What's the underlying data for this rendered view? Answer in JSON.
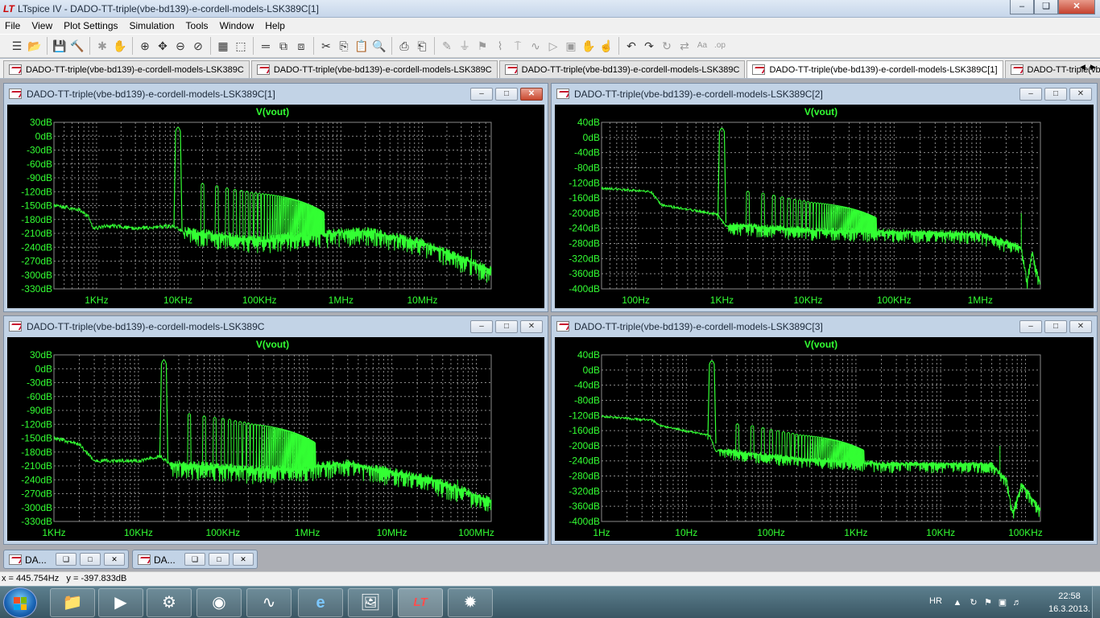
{
  "window": {
    "app_logo": "LT",
    "title": "LTspice IV - DADO-TT-triple(vbe-bd139)-e-cordell-models-LSK389C[1]",
    "minimize": "–",
    "maximize": "❏",
    "close": "✕"
  },
  "menu": [
    "File",
    "View",
    "Plot Settings",
    "Simulation",
    "Tools",
    "Window",
    "Help"
  ],
  "toolbar_icons": [
    {
      "name": "new-schematic-icon",
      "glyph": "☰",
      "enabled": true
    },
    {
      "name": "open-icon",
      "glyph": "📂",
      "enabled": true
    },
    {
      "name": "save-icon",
      "glyph": "💾",
      "enabled": true
    },
    {
      "name": "control-panel-icon",
      "glyph": "🔨",
      "enabled": true
    },
    {
      "name": "run-icon",
      "glyph": "✱",
      "enabled": false
    },
    {
      "name": "pan-icon",
      "glyph": "✋",
      "enabled": false
    },
    {
      "name": "zoom-in-icon",
      "glyph": "⊕",
      "enabled": true
    },
    {
      "name": "zoom-pan-icon",
      "glyph": "✥",
      "enabled": true
    },
    {
      "name": "zoom-out-icon",
      "glyph": "⊖",
      "enabled": true
    },
    {
      "name": "zoom-cancel-icon",
      "glyph": "⊘",
      "enabled": true
    },
    {
      "name": "autorange-icon",
      "glyph": "▦",
      "enabled": true
    },
    {
      "name": "fit-icon",
      "glyph": "⬚",
      "enabled": true
    },
    {
      "name": "tile-horizontal-icon",
      "glyph": "═",
      "enabled": true
    },
    {
      "name": "cascade-icon",
      "glyph": "⧉",
      "enabled": true
    },
    {
      "name": "close-windows-icon",
      "glyph": "⧈",
      "enabled": true
    },
    {
      "name": "cut-icon",
      "glyph": "✂",
      "enabled": true
    },
    {
      "name": "copy-icon",
      "glyph": "⎘",
      "enabled": true
    },
    {
      "name": "paste-icon",
      "glyph": "📋",
      "enabled": true
    },
    {
      "name": "find-icon",
      "glyph": "🔍",
      "enabled": true
    },
    {
      "name": "print-preview-icon",
      "glyph": "⎙",
      "enabled": true
    },
    {
      "name": "print-icon",
      "glyph": "⎗",
      "enabled": true
    },
    {
      "name": "wire-icon",
      "glyph": "✎",
      "enabled": false
    },
    {
      "name": "ground-icon",
      "glyph": "⏚",
      "enabled": false
    },
    {
      "name": "label-icon",
      "glyph": "⚑",
      "enabled": false
    },
    {
      "name": "resistor-icon",
      "glyph": "⌇",
      "enabled": false
    },
    {
      "name": "capacitor-icon",
      "glyph": "⍑",
      "enabled": false
    },
    {
      "name": "inductor-icon",
      "glyph": "∿",
      "enabled": false
    },
    {
      "name": "diode-icon",
      "glyph": "▷",
      "enabled": false
    },
    {
      "name": "component-icon",
      "glyph": "▣",
      "enabled": false
    },
    {
      "name": "move-icon",
      "glyph": "✋",
      "enabled": false
    },
    {
      "name": "drag-icon",
      "glyph": "☝",
      "enabled": false
    },
    {
      "name": "undo-icon",
      "glyph": "↶",
      "enabled": true
    },
    {
      "name": "redo-icon",
      "glyph": "↷",
      "enabled": true
    },
    {
      "name": "rotate-icon",
      "glyph": "↻",
      "enabled": false
    },
    {
      "name": "mirror-icon",
      "glyph": "⇄",
      "enabled": false
    },
    {
      "name": "text-icon",
      "glyph": "Aa",
      "enabled": false
    },
    {
      "name": "spice-directive-icon",
      "glyph": ".op",
      "enabled": false
    }
  ],
  "doc_tabs": [
    {
      "label": "DADO-TT-triple(vbe-bd139)-e-cordell-models-LSK389C",
      "kind": "schematic",
      "active": false
    },
    {
      "label": "DADO-TT-triple(vbe-bd139)-e-cordell-models-LSK389C",
      "kind": "plot",
      "active": false
    },
    {
      "label": "DADO-TT-triple(vbe-bd139)-e-cordell-models-LSK389C",
      "kind": "plot",
      "active": false
    },
    {
      "label": "DADO-TT-triple(vbe-bd139)-e-cordell-models-LSK389C[1]",
      "kind": "plot",
      "active": true
    },
    {
      "label": "DADO-TT-triple(vbe-bd13",
      "kind": "plot",
      "active": false
    }
  ],
  "tab_scroll": [
    "◀",
    "▶"
  ],
  "panes": [
    {
      "id": "pane-1",
      "title": "DADO-TT-triple(vbe-bd139)-e-cordell-models-LSK389C[1]",
      "active": true,
      "trace_label": "V(vout)",
      "colors": {
        "trace": "#33ff33",
        "grid": "#8a8a8a",
        "axis": "#33ff33"
      },
      "chart_data": {
        "type": "line",
        "x_scale": "log",
        "y_unit": "dB",
        "xlim_hz": [
          300,
          70000000
        ],
        "ylim_db": [
          -330,
          30
        ],
        "y_ticks": [
          30,
          0,
          -30,
          -60,
          -90,
          -120,
          -150,
          -180,
          -210,
          -240,
          -270,
          -300,
          -330
        ],
        "y_tick_labels": [
          "30dB",
          "0dB",
          "-30dB",
          "-60dB",
          "-90dB",
          "-120dB",
          "-150dB",
          "-180dB",
          "-210dB",
          "-240dB",
          "-270dB",
          "-300dB",
          "-330dB"
        ],
        "x_ticks": [
          1000,
          10000,
          100000,
          1000000,
          10000000
        ],
        "x_tick_labels": [
          "1KHz",
          "10KHz",
          "100KHz",
          "1MHz",
          "10MHz"
        ],
        "fundamental_hz": 10000,
        "fundamental_db": 20,
        "harmonic_peak_db": [
          -105,
          -110,
          -115,
          -118,
          -120,
          -122,
          -124,
          -125,
          -126,
          -127
        ],
        "noise_floor": [
          {
            "x": 300,
            "y": -145
          },
          {
            "x": 600,
            "y": -155
          },
          {
            "x": 800,
            "y": -170
          },
          {
            "x": 900,
            "y": -195
          },
          {
            "x": 1500,
            "y": -190
          },
          {
            "x": 3000,
            "y": -195
          },
          {
            "x": 9000,
            "y": -190
          },
          {
            "x": 12000,
            "y": -205
          },
          {
            "x": 100000,
            "y": -225
          },
          {
            "x": 300000,
            "y": -215
          },
          {
            "x": 2000000,
            "y": -205
          },
          {
            "x": 10000000,
            "y": -230
          },
          {
            "x": 70000000,
            "y": -290
          }
        ],
        "noise_band_db": 40,
        "spurs": [
          {
            "x": 40000000,
            "y": -245
          }
        ]
      }
    },
    {
      "id": "pane-2",
      "title": "DADO-TT-triple(vbe-bd139)-e-cordell-models-LSK389C[2]",
      "active": false,
      "trace_label": "V(vout)",
      "colors": {
        "trace": "#33ff33",
        "grid": "#8a8a8a",
        "axis": "#33ff33"
      },
      "chart_data": {
        "type": "line",
        "x_scale": "log",
        "y_unit": "dB",
        "xlim_hz": [
          40,
          5000000
        ],
        "ylim_db": [
          -400,
          40
        ],
        "y_ticks": [
          40,
          0,
          -40,
          -80,
          -120,
          -160,
          -200,
          -240,
          -280,
          -320,
          -360,
          -400
        ],
        "y_tick_labels": [
          "40dB",
          "0dB",
          "-40dB",
          "-80dB",
          "-120dB",
          "-160dB",
          "-200dB",
          "-240dB",
          "-280dB",
          "-320dB",
          "-360dB",
          "-400dB"
        ],
        "x_ticks": [
          100,
          1000,
          10000,
          100000,
          1000000
        ],
        "x_tick_labels": [
          "100Hz",
          "1KHz",
          "10KHz",
          "100KHz",
          "1MHz"
        ],
        "fundamental_hz": 1000,
        "fundamental_db": 25,
        "harmonic_peak_db": [
          -145,
          -150,
          -155,
          -160,
          -163,
          -166,
          -168,
          -170,
          -172,
          -174
        ],
        "noise_floor": [
          {
            "x": 40,
            "y": -130
          },
          {
            "x": 150,
            "y": -140
          },
          {
            "x": 200,
            "y": -175
          },
          {
            "x": 900,
            "y": -200
          },
          {
            "x": 1100,
            "y": -230
          },
          {
            "x": 10000,
            "y": -245
          },
          {
            "x": 100000,
            "y": -250
          },
          {
            "x": 1000000,
            "y": -255
          },
          {
            "x": 3000000,
            "y": -290
          },
          {
            "x": 3500000,
            "y": -380
          },
          {
            "x": 4000000,
            "y": -300
          },
          {
            "x": 5000000,
            "y": -390
          }
        ],
        "noise_band_db": 35,
        "spurs": [
          {
            "x": 3000000,
            "y": -200
          }
        ]
      }
    },
    {
      "id": "pane-3",
      "title": "DADO-TT-triple(vbe-bd139)-e-cordell-models-LSK389C",
      "active": false,
      "trace_label": "V(vout)",
      "colors": {
        "trace": "#33ff33",
        "grid": "#8a8a8a",
        "axis": "#33ff33"
      },
      "chart_data": {
        "type": "line",
        "x_scale": "log",
        "y_unit": "dB",
        "xlim_hz": [
          1000,
          150000000
        ],
        "ylim_db": [
          -330,
          30
        ],
        "y_ticks": [
          30,
          0,
          -30,
          -60,
          -90,
          -120,
          -150,
          -180,
          -210,
          -240,
          -270,
          -300,
          -330
        ],
        "y_tick_labels": [
          "30dB",
          "0dB",
          "-30dB",
          "-60dB",
          "-90dB",
          "-120dB",
          "-150dB",
          "-180dB",
          "-210dB",
          "-240dB",
          "-270dB",
          "-300dB",
          "-330dB"
        ],
        "x_ticks": [
          1000,
          10000,
          100000,
          1000000,
          10000000,
          100000000
        ],
        "x_tick_labels": [
          "1KHz",
          "10KHz",
          "100KHz",
          "1MHz",
          "10MHz",
          "100MHz"
        ],
        "fundamental_hz": 20000,
        "fundamental_db": 20,
        "harmonic_peak_db": [
          -100,
          -105,
          -108,
          -110,
          -112,
          -115,
          -117,
          -118,
          -120,
          -122
        ],
        "noise_floor": [
          {
            "x": 1000,
            "y": -145
          },
          {
            "x": 2000,
            "y": -160
          },
          {
            "x": 3000,
            "y": -195
          },
          {
            "x": 10000,
            "y": -195
          },
          {
            "x": 18000,
            "y": -185
          },
          {
            "x": 25000,
            "y": -205
          },
          {
            "x": 300000,
            "y": -220
          },
          {
            "x": 3000000,
            "y": -205
          },
          {
            "x": 30000000,
            "y": -240
          },
          {
            "x": 150000000,
            "y": -285
          }
        ],
        "noise_band_db": 40,
        "spurs": [
          {
            "x": 60000000,
            "y": -240
          }
        ]
      }
    },
    {
      "id": "pane-4",
      "title": "DADO-TT-triple(vbe-bd139)-e-cordell-models-LSK389C[3]",
      "active": false,
      "trace_label": "V(vout)",
      "colors": {
        "trace": "#33ff33",
        "grid": "#8a8a8a",
        "axis": "#33ff33"
      },
      "chart_data": {
        "type": "line",
        "x_scale": "log",
        "y_unit": "dB",
        "xlim_hz": [
          1,
          150000
        ],
        "ylim_db": [
          -400,
          40
        ],
        "y_ticks": [
          40,
          0,
          -40,
          -80,
          -120,
          -160,
          -200,
          -240,
          -280,
          -320,
          -360,
          -400
        ],
        "y_tick_labels": [
          "40dB",
          "0dB",
          "-40dB",
          "-80dB",
          "-120dB",
          "-160dB",
          "-200dB",
          "-240dB",
          "-280dB",
          "-320dB",
          "-360dB",
          "-400dB"
        ],
        "x_ticks": [
          1,
          10,
          100,
          1000,
          10000,
          100000
        ],
        "x_tick_labels": [
          "1Hz",
          "10Hz",
          "100Hz",
          "1KHz",
          "10KHz",
          "100KHz"
        ],
        "fundamental_hz": 20,
        "fundamental_db": 25,
        "harmonic_peak_db": [
          -145,
          -150,
          -155,
          -160,
          -163,
          -166,
          -168,
          -170,
          -172,
          -174
        ],
        "noise_floor": [
          {
            "x": 1,
            "y": -120
          },
          {
            "x": 4,
            "y": -130
          },
          {
            "x": 5,
            "y": -145
          },
          {
            "x": 19,
            "y": -170
          },
          {
            "x": 22,
            "y": -210
          },
          {
            "x": 200,
            "y": -235
          },
          {
            "x": 2000,
            "y": -248
          },
          {
            "x": 40000,
            "y": -250
          },
          {
            "x": 60000,
            "y": -290
          },
          {
            "x": 70000,
            "y": -380
          },
          {
            "x": 90000,
            "y": -300
          },
          {
            "x": 150000,
            "y": -370
          }
        ],
        "noise_band_db": 30,
        "spurs": [
          {
            "x": 50000,
            "y": -200
          }
        ]
      }
    }
  ],
  "minimized": [
    {
      "label": "DA...",
      "icon": "schematic"
    },
    {
      "label": "DA...",
      "icon": "schematic"
    }
  ],
  "min_ctrls": [
    "❏",
    "□",
    "✕"
  ],
  "status": {
    "cursor": "x = 445.754Hz   y = -397.833dB"
  },
  "taskbar": {
    "apps": [
      {
        "name": "explorer-task",
        "glyph": "📁",
        "active": false
      },
      {
        "name": "media-task",
        "glyph": "▶",
        "active": false
      },
      {
        "name": "tool-task",
        "glyph": "⚙",
        "active": false
      },
      {
        "name": "security-task",
        "glyph": "◉",
        "active": false
      },
      {
        "name": "scope-task",
        "glyph": "∿",
        "active": false
      },
      {
        "name": "ie-task",
        "glyph": "e",
        "active": false
      },
      {
        "name": "folder-task",
        "glyph": "🖼",
        "active": false
      },
      {
        "name": "ltspice-task",
        "glyph": "LT",
        "active": true
      },
      {
        "name": "splat-task",
        "glyph": "✹",
        "active": false
      }
    ],
    "language": "HR",
    "time": "22:58",
    "date": "16.3.2013."
  }
}
